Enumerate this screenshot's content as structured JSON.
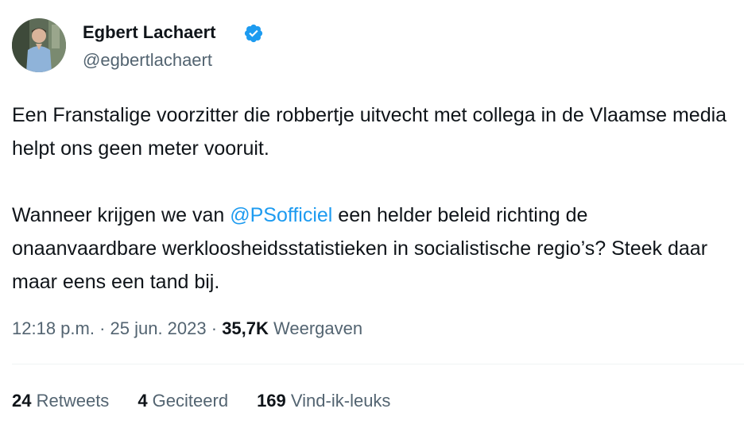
{
  "author": {
    "display_name": "Egbert Lachaert",
    "handle": "@egbertlachaert",
    "verified": true,
    "verified_color": "#1d9bf0"
  },
  "tweet": {
    "paragraph1": "Een Franstalige voorzitter die robbertje uitvecht met collega in de Vlaamse media helpt ons geen meter vooruit.",
    "paragraph2_before": "Wanneer krijgen we van ",
    "mention": "@PSofficiel",
    "paragraph2_after": " een helder beleid richting de onaanvaardbare werkloosheidsstatistieken in socialistische regio’s? Steek daar maar eens een tand bij."
  },
  "meta": {
    "time": "12:18 p.m.",
    "separator1": " · ",
    "date": "25 jun. 2023",
    "separator2": " · ",
    "views_count": "35,7K",
    "views_label": " Weergaven"
  },
  "stats": {
    "retweets_count": "24",
    "retweets_label": " Retweets",
    "quotes_count": "4",
    "quotes_label": " Geciteerd",
    "likes_count": "169",
    "likes_label": " Vind-ik-leuks"
  },
  "colors": {
    "text": "#0f1419",
    "secondary": "#536471",
    "link": "#1d9bf0"
  }
}
